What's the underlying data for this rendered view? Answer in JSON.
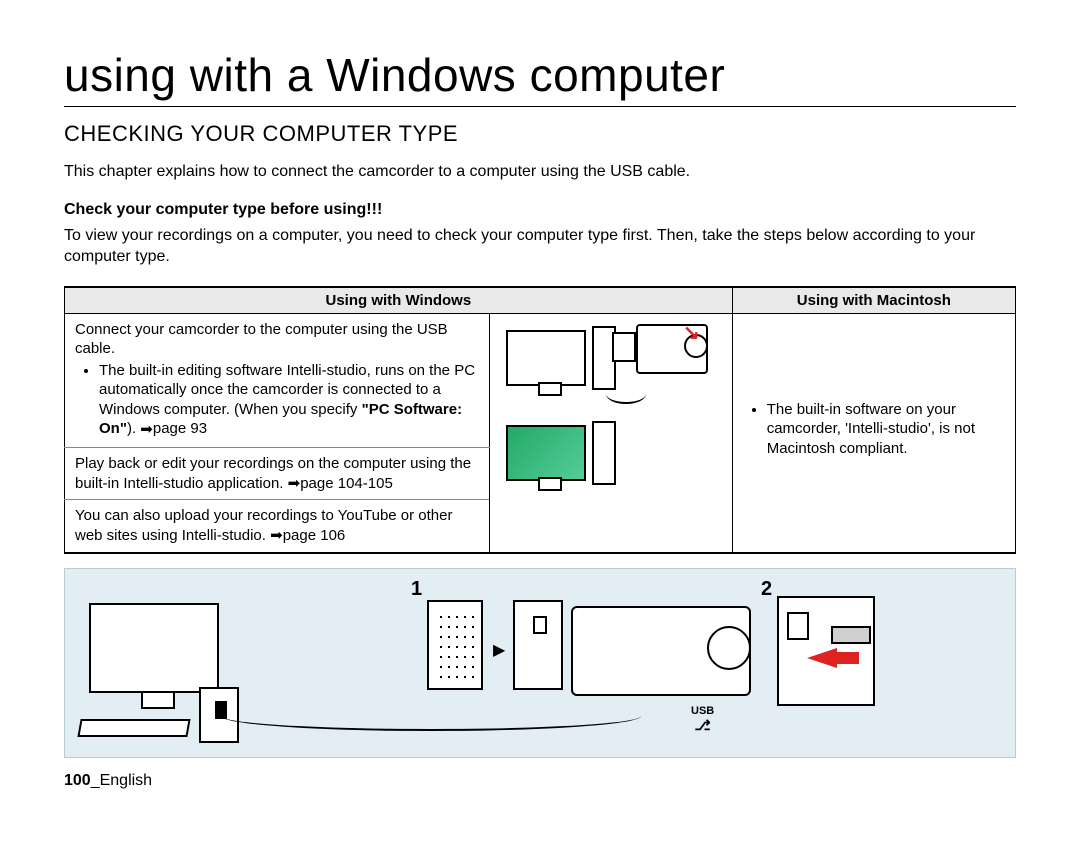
{
  "page": {
    "title": "using with a Windows computer",
    "section_title": "CHECKING YOUR COMPUTER TYPE",
    "intro": "This chapter explains how to connect the camcorder to a computer using the USB cable.",
    "check_heading": "Check your computer type before using!!!",
    "check_body": "To view your recordings on a computer, you need to check your computer type first. Then, take the steps below according to your computer type."
  },
  "table": {
    "col_windows": "Using with Windows",
    "col_macintosh": "Using with Macintosh",
    "row1_intro": "Connect your camcorder to the computer using the USB cable.",
    "row1_bullet_pre": "The built-in editing software Intelli-studio, runs on the PC automatically once the camcorder is connected to a Windows computer. (When you specify ",
    "row1_bullet_bold": "\"PC Software: On\"",
    "row1_bullet_post": "). ",
    "row1_pageref": "page 93",
    "row2_text": "Play back or edit your recordings on the computer using the built-in Intelli-studio application. ",
    "row2_pageref": "page 104-105",
    "row3_text": "You can also upload your recordings to YouTube or other web sites using Intelli-studio. ",
    "row3_pageref": "page 106",
    "mac_bullet": "The built-in software on your camcorder, 'Intelli-studio', is not Macintosh compliant."
  },
  "diagram": {
    "step1": "1",
    "step2": "2",
    "usb_label": "USB"
  },
  "footer": {
    "page_num": "100",
    "lang": "_English"
  }
}
